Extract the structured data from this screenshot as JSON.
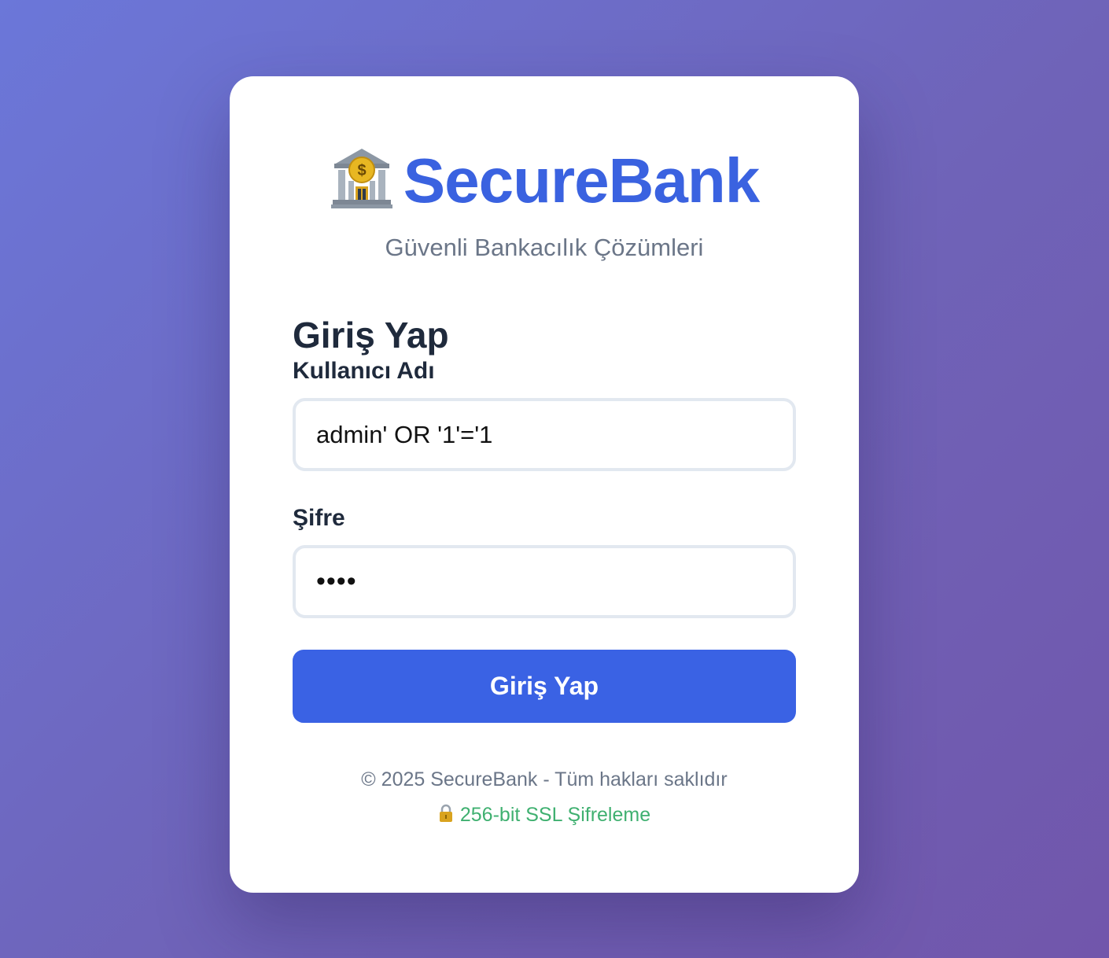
{
  "brand": {
    "icon": "bank-icon",
    "name": "SecureBank",
    "tagline": "Güvenli Bankacılık Çözümleri",
    "color": "#3a62e0"
  },
  "login_form": {
    "title": "Giriş Yap",
    "username": {
      "label": "Kullanıcı Adı",
      "value": "admin' OR '1'='1"
    },
    "password": {
      "label": "Şifre",
      "value": "••••"
    },
    "submit_label": "Giriş Yap",
    "submit_color": "#3a62e4"
  },
  "footer": {
    "copyright": "© 2025 SecureBank - Tüm hakları saklıdır",
    "ssl_icon": "lock-icon",
    "ssl_text": "256-bit SSL Şifreleme",
    "ssl_color": "#3fb070"
  }
}
